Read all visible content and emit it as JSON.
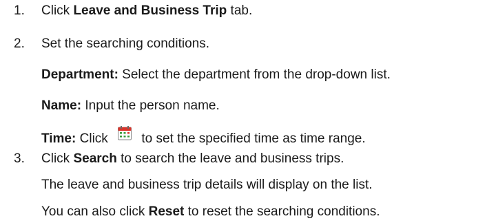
{
  "steps": [
    {
      "number": "1.",
      "prefix": "Click ",
      "bold": "Leave and Business Trip",
      "suffix": " tab."
    },
    {
      "number": "2.",
      "text": "Set the searching conditions.",
      "details": [
        {
          "label": "Department:",
          "text": " Select the department from the drop-down list."
        },
        {
          "label": "Name:",
          "text": " Input the person name."
        },
        {
          "label": "Time:",
          "before_icon": " Click ",
          "icon": "calendar-icon",
          "after_icon": " to set the specified time as time range."
        }
      ]
    },
    {
      "number": "3.",
      "prefix": "Click ",
      "bold": "Search",
      "suffix": " to search the leave and business trips.",
      "notes": [
        {
          "text": "The leave and business trip details will display on the list."
        },
        {
          "prefix": "You can also click ",
          "bold": "Reset",
          "suffix": " to reset the searching conditions."
        }
      ]
    }
  ],
  "colors": {
    "text": "#1a1a1a",
    "calendar_red": "#d9342b",
    "calendar_green": "#3a9a3a"
  }
}
